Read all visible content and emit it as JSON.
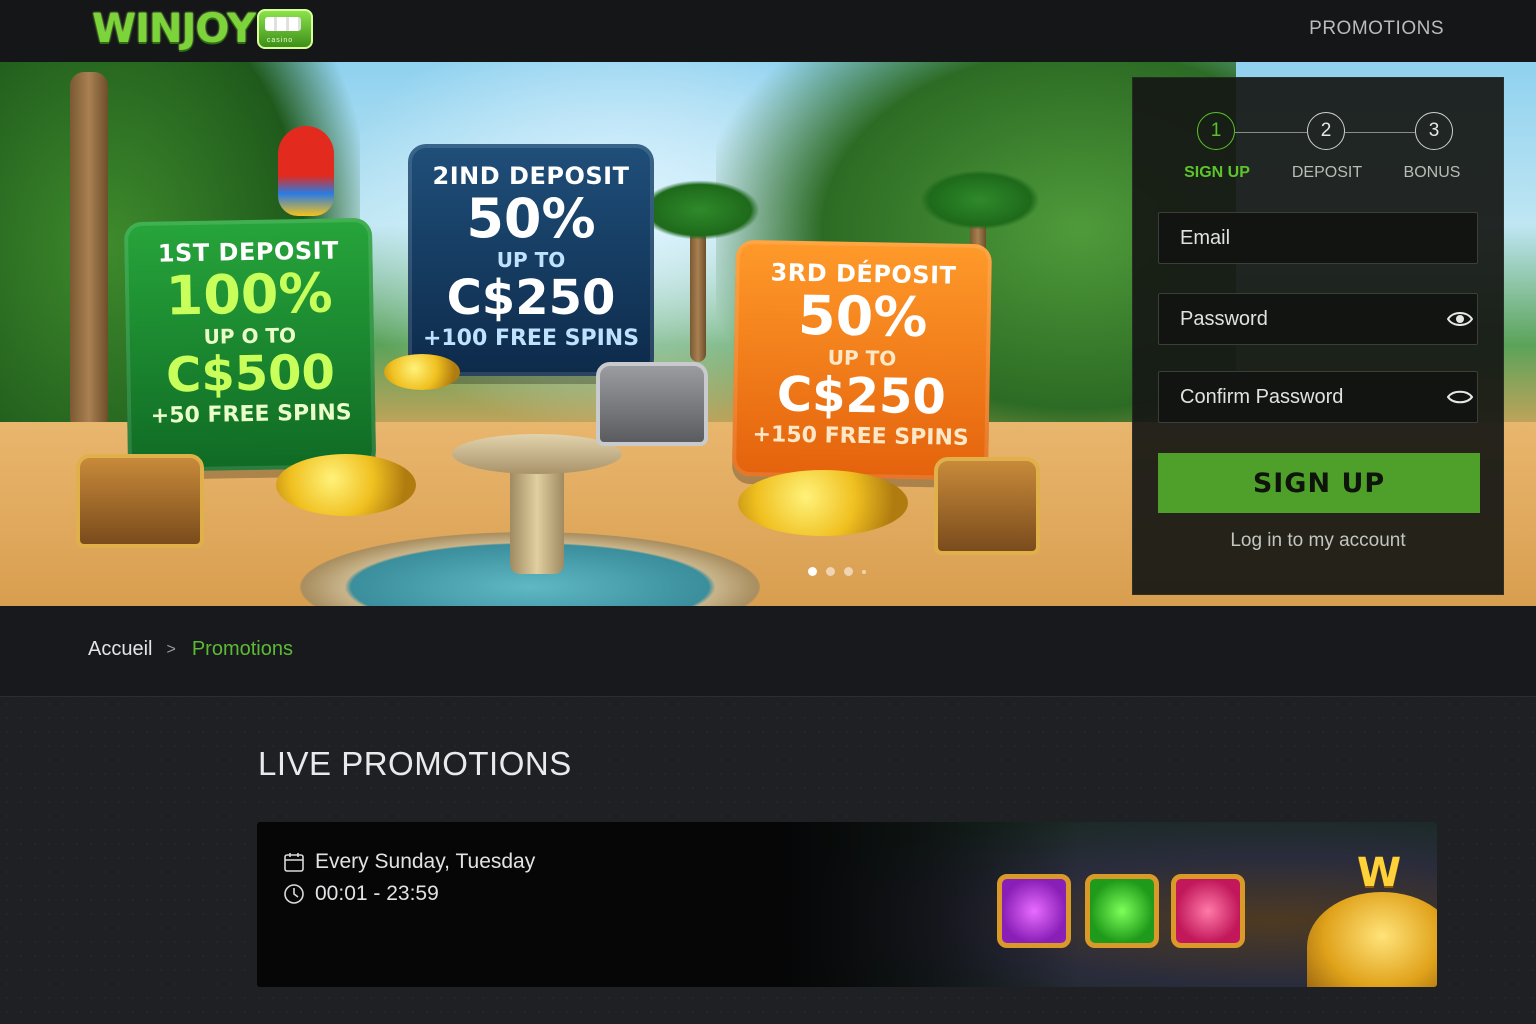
{
  "header": {
    "logo_text": "WINJOY",
    "logo_sub": "casino",
    "nav_promotions": "PROMOTIONS"
  },
  "hero": {
    "cards": [
      {
        "head": "1ST DEPOSIT",
        "percent": "100%",
        "upto": "UP O TO",
        "amount": "C$500",
        "spins": "+50 FREE SPINS"
      },
      {
        "head": "2IND DEPOSIT",
        "percent": "50%",
        "upto": "UP TO",
        "amount": "C$250",
        "spins": "+100 FREE SPINS"
      },
      {
        "head": "3RD DÉPOSIT",
        "percent": "50%",
        "upto": "UP TO",
        "amount": "C$250",
        "spins": "+150 FREE SPINS"
      }
    ],
    "carousel_active_index": 0,
    "carousel_count": 4
  },
  "signup": {
    "steps": [
      {
        "number": "1",
        "label": "SIGN UP"
      },
      {
        "number": "2",
        "label": "DEPOSIT"
      },
      {
        "number": "3",
        "label": "BONUS"
      }
    ],
    "active_step": 1,
    "email_placeholder": "Email",
    "password_placeholder": "Password",
    "confirm_placeholder": "Confirm Password",
    "button_label": "SIGN UP",
    "login_link": "Log in to my account",
    "accent_color": "#4ea02a"
  },
  "breadcrumb": {
    "home": "Accueil",
    "separator": ">",
    "current": "Promotions"
  },
  "live_promotions": {
    "title": "LIVE PROMOTIONS",
    "items": [
      {
        "days": "Every Sunday, Tuesday",
        "time": "00:01 - 23:59",
        "art_mark": "W"
      }
    ]
  },
  "icons": [
    "calendar-icon",
    "clock-icon",
    "eye-icon",
    "eye-closed-icon"
  ]
}
